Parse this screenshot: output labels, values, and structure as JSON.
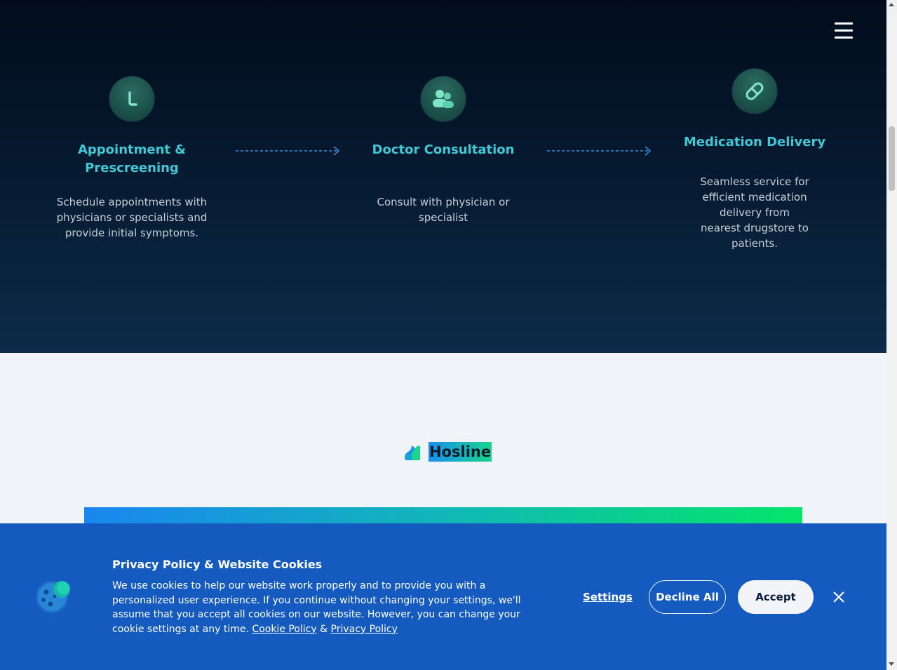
{
  "nav": {
    "menu_icon": "hamburger-menu-icon"
  },
  "steps": [
    {
      "icon": "clock-icon",
      "title": "Appointment & Prescreening",
      "description": "Schedule appointments with physicians or specialists and provide initial symptoms."
    },
    {
      "icon": "people-icon",
      "title": "Doctor Consultation",
      "description": "Consult with physician or specialist"
    },
    {
      "icon": "pills-icon",
      "title": "Medication Delivery",
      "description": "Seamless service for efficient medication delivery from nearest drugstore to patients."
    }
  ],
  "brand": {
    "name": "Hosline",
    "logo_icon": "hosline-logo-icon"
  },
  "cookie_banner": {
    "icon": "cookie-icon",
    "title": "Privacy Policy & Website Cookies",
    "text": "We use cookies to help our website work properly and to provide you with a personalized user experience. If you continue without changing your settings, we'll assume that you accept all cookies on our website. However, you can change your cookie settings at any time.",
    "cookie_policy_link": "Cookie Policy",
    "and": "&",
    "privacy_policy_link": "Privacy Policy",
    "settings_label": "Settings",
    "decline_label": "Decline All",
    "accept_label": "Accept",
    "close_icon": "close-icon"
  },
  "colors": {
    "accent_teal": "#3fc9d6",
    "banner_blue": "#155bbf",
    "gradient_start": "#1a86f0",
    "gradient_end": "#04e56a"
  }
}
